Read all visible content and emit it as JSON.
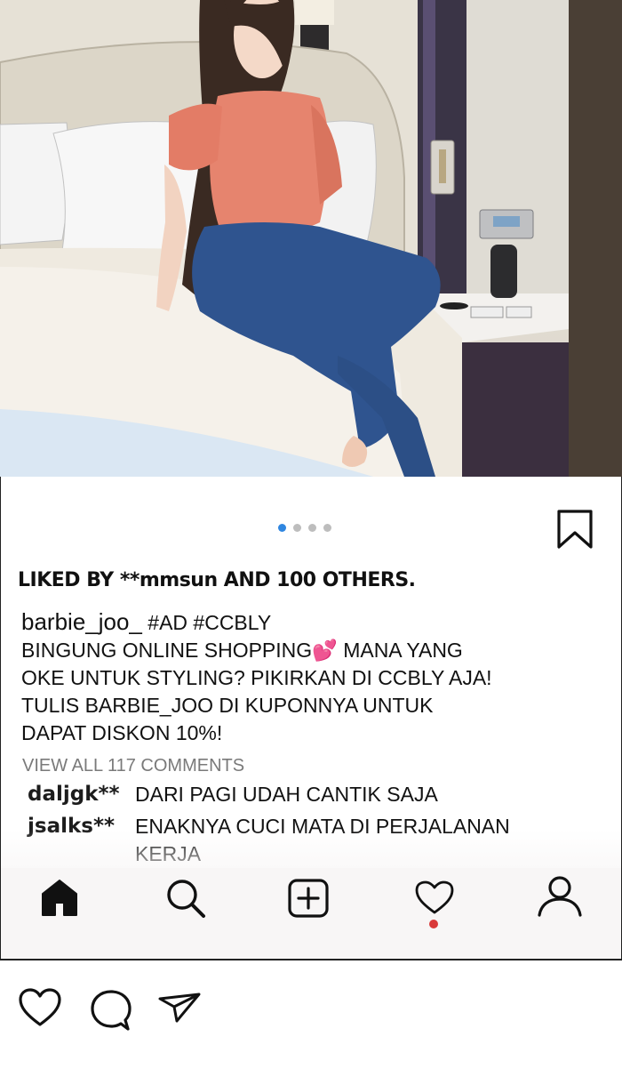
{
  "post": {
    "liked_text": "LIKED BY **mmsun AND 100 OTHERS.",
    "username": "barbie_joo_",
    "hashtags": "#AD #CCBLY",
    "caption_lines": [
      "BINGUNG ONLINE SHOPPING💕    MANA YANG",
      "OKE UNTUK STYLING? PIKIRKAN DI CCBLY AJA!",
      "TULIS BARBIE_JOO DI KUPONNYA UNTUK",
      "DAPAT DISKON 10%!"
    ],
    "view_all_comments": "VIEW ALL 117 COMMENTS",
    "comments": [
      {
        "user": "daljgk**",
        "text": "DARI PAGI UDAH CANTIK SAJA"
      },
      {
        "user": "jsalks**",
        "text": "ENAKNYA CUCI MATA DI PERJALANAN KERJA"
      }
    ],
    "carousel": {
      "count": 4,
      "active_index": 0
    }
  },
  "actions": {
    "like_icon": "heart-outline-icon",
    "comment_icon": "speech-bubble-icon",
    "share_icon": "paper-plane-icon",
    "save_icon": "bookmark-icon"
  },
  "nav": {
    "items": [
      {
        "icon": "home-icon"
      },
      {
        "icon": "search-icon"
      },
      {
        "icon": "add-post-icon"
      },
      {
        "icon": "heart-icon",
        "has_notification": true
      },
      {
        "icon": "profile-icon"
      }
    ]
  },
  "colors": {
    "accent_dot": "#2f86e0",
    "notification": "#d93a3a",
    "text": "#111111",
    "muted": "#7a7a7a"
  }
}
